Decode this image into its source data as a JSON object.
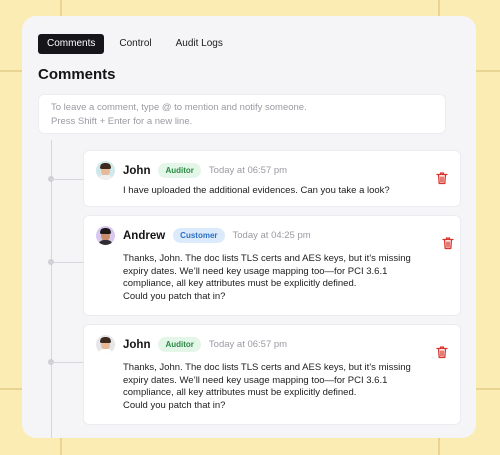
{
  "tabs": [
    {
      "label": "Comments",
      "active": true
    },
    {
      "label": "Control",
      "active": false
    },
    {
      "label": "Audit Logs",
      "active": false
    }
  ],
  "page_title": "Comments",
  "composer": {
    "placeholder_line1": "To leave a comment, type @ to mention and notify someone.",
    "placeholder_line2": "Press Shift + Enter for a new line."
  },
  "comments": [
    {
      "author": "John",
      "role": "Auditor",
      "time": "Today at 06:57 pm",
      "lines": [
        "I have uploaded the additional evidences. Can you take a look?"
      ]
    },
    {
      "author": "Andrew",
      "role": "Customer",
      "time": "Today at 04:25 pm",
      "lines": [
        "Thanks, John. The doc lists TLS certs and AES keys, but it’s missing",
        "expiry dates. We’ll need key usage mapping too—for PCI 3.6.1",
        "compliance, all key attributes must be explicitly defined.",
        "Could you patch that in?"
      ]
    },
    {
      "author": "John",
      "role": "Auditor",
      "time": "Today at 06:57 pm",
      "lines": [
        "Thanks, John. The doc lists TLS certs and AES keys, but it’s missing",
        "expiry dates. We’ll need key usage mapping too—for PCI 3.6.1",
        "compliance, all key attributes must be explicitly defined.",
        "Could you patch that in?"
      ]
    }
  ],
  "icons": {
    "delete": "trash-icon"
  },
  "colors": {
    "delete": "#d9342b",
    "active_tab": "#16161a",
    "auditor_badge": "#2a8a43",
    "customer_badge": "#2b6fc4"
  }
}
